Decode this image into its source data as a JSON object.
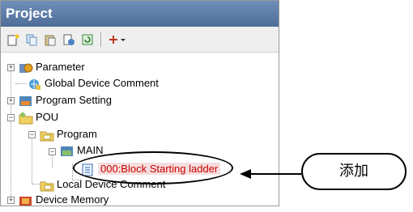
{
  "panel": {
    "title": "Project"
  },
  "toolbar": {
    "icons": [
      "new-item-icon",
      "copy-icon",
      "paste-icon",
      "properties-icon",
      "refresh-icon",
      "toggle-dropdown-icon"
    ]
  },
  "tree": {
    "parameter": "Parameter",
    "global_device_comment": "Global Device Comment",
    "program_setting": "Program Setting",
    "pou": "POU",
    "program": "Program",
    "main": "MAIN",
    "block_starting_ladder": "000:Block Starting ladder",
    "local_device_comment": "Local Device Comment",
    "device_memory": "Device Memory"
  },
  "callout": {
    "label": "添加"
  },
  "colors": {
    "title_bar": "#5f7fa8",
    "selected_text": "#cc0000",
    "selected_bg": "#f6dede"
  }
}
